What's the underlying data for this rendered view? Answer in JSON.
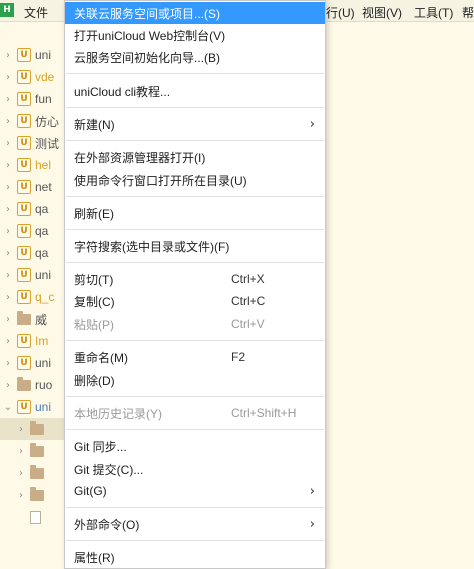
{
  "menubar": {
    "logo": "H",
    "file": "文件",
    "run": "行(U)",
    "view": "视图(V)",
    "tools": "工具(T)",
    "help": "帮"
  },
  "tree": {
    "items": [
      {
        "label": "uni",
        "icon": "u-project-icon"
      },
      {
        "label": "vde",
        "icon": "u-project-icon"
      },
      {
        "label": "fun",
        "icon": "u-project-icon"
      },
      {
        "label": "仿心",
        "icon": "u-project-icon"
      },
      {
        "label": "测试",
        "icon": "u-project-icon"
      },
      {
        "label": "hel",
        "icon": "u-project-icon"
      },
      {
        "label": "net",
        "icon": "u-project-icon"
      },
      {
        "label": "qa",
        "icon": "u-project-icon"
      },
      {
        "label": "qa",
        "icon": "u-project-icon"
      },
      {
        "label": "qa",
        "icon": "u-project-icon"
      },
      {
        "label": "uni",
        "icon": "u-project-icon"
      },
      {
        "label": "q_c",
        "icon": "u-project-icon"
      },
      {
        "label": "威",
        "icon": "folder-icon"
      },
      {
        "label": "Im",
        "icon": "u-project-icon"
      },
      {
        "label": "uni",
        "icon": "u-project-icon"
      },
      {
        "label": "ruo",
        "icon": "folder-icon"
      },
      {
        "label": "uni",
        "icon": "u-project-icon"
      }
    ]
  },
  "menu": {
    "items": [
      {
        "label": "关联云服务空间或项目...(S)"
      },
      {
        "label": "打开uniCloud Web控制台(V)"
      },
      {
        "label": "云服务空间初始化向导...(B)"
      },
      {
        "label": "uniCloud cli教程..."
      },
      {
        "label": "新建(N)"
      },
      {
        "label": "在外部资源管理器打开(I)"
      },
      {
        "label": "使用命令行窗口打开所在目录(U)"
      },
      {
        "label": "刷新(E)"
      },
      {
        "label": "字符搜索(选中目录或文件)(F)"
      },
      {
        "label": "剪切(T)",
        "shortcut": "Ctrl+X"
      },
      {
        "label": "复制(C)",
        "shortcut": "Ctrl+C"
      },
      {
        "label": "粘贴(P)",
        "shortcut": "Ctrl+V"
      },
      {
        "label": "重命名(M)",
        "shortcut": "F2"
      },
      {
        "label": "删除(D)"
      },
      {
        "label": "本地历史记录(Y)",
        "shortcut": "Ctrl+Shift+H"
      },
      {
        "label": "Git 同步..."
      },
      {
        "label": "Git 提交(C)..."
      },
      {
        "label": "Git(G)"
      },
      {
        "label": "外部命令(O)"
      },
      {
        "label": "属性(R)"
      }
    ],
    "submenu_arrow": "›"
  },
  "colors": {
    "highlight": "#3399ff",
    "background": "#fffae8",
    "project_icon": "#d9a22a"
  }
}
